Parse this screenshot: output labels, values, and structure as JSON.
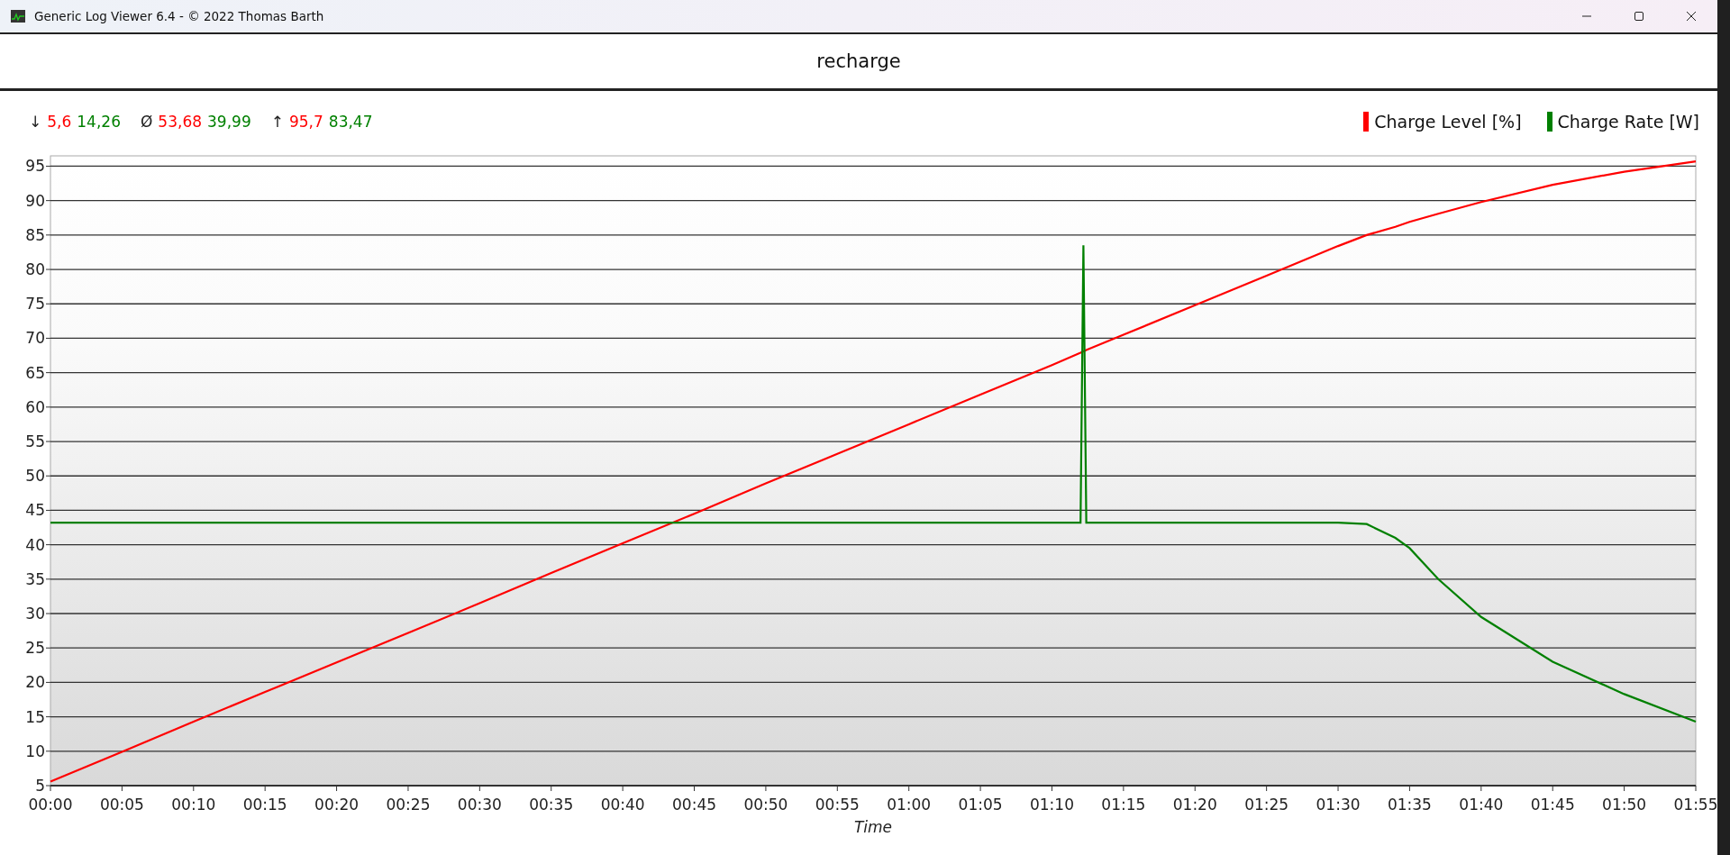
{
  "window": {
    "title": "Generic Log Viewer 6.4 - © 2022 Thomas Barth"
  },
  "header": {
    "title": "recharge"
  },
  "stats": [
    {
      "symbol": "↓",
      "values": [
        {
          "text": "5,6",
          "color": "#ff0000"
        },
        {
          "text": "14,26",
          "color": "#008000"
        }
      ]
    },
    {
      "symbol": "Ø",
      "values": [
        {
          "text": "53,68",
          "color": "#ff0000"
        },
        {
          "text": "39,99",
          "color": "#008000"
        }
      ]
    },
    {
      "symbol": "↑",
      "values": [
        {
          "text": "95,7",
          "color": "#ff0000"
        },
        {
          "text": "83,47",
          "color": "#008000"
        }
      ]
    }
  ],
  "chart_data": {
    "type": "line",
    "grid": true,
    "xlabel": "Time",
    "x": [
      0,
      5,
      10,
      15,
      20,
      25,
      30,
      35,
      40,
      45,
      50,
      55,
      60,
      65,
      70,
      72,
      72.2,
      72.4,
      75,
      80,
      85,
      90,
      92,
      94,
      95,
      97,
      100,
      105,
      110,
      115
    ],
    "series": [
      {
        "name": "Charge Level [%]",
        "color": "#ff0000",
        "values": [
          5.6,
          9.9,
          14.3,
          18.6,
          22.9,
          27.2,
          31.5,
          35.9,
          40.2,
          44.5,
          48.9,
          53.2,
          57.5,
          61.8,
          66.1,
          67.9,
          68.1,
          68.3,
          70.5,
          74.8,
          79.1,
          83.4,
          85.0,
          86.2,
          86.9,
          88.1,
          89.8,
          92.3,
          94.2,
          95.7
        ]
      },
      {
        "name": "Charge Rate [W]",
        "color": "#008000",
        "values": [
          43.2,
          43.2,
          43.2,
          43.2,
          43.2,
          43.2,
          43.2,
          43.2,
          43.2,
          43.2,
          43.2,
          43.2,
          43.2,
          43.2,
          43.2,
          43.2,
          83.5,
          43.2,
          43.2,
          43.2,
          43.2,
          43.2,
          43.0,
          41.0,
          39.5,
          35.0,
          29.5,
          23.0,
          18.3,
          14.3
        ]
      }
    ],
    "xlim": [
      0,
      115
    ],
    "ylim": [
      5,
      96.5
    ],
    "xticks": [
      {
        "value": 0,
        "label": "00:00"
      },
      {
        "value": 5,
        "label": "00:05"
      },
      {
        "value": 10,
        "label": "00:10"
      },
      {
        "value": 15,
        "label": "00:15"
      },
      {
        "value": 20,
        "label": "00:20"
      },
      {
        "value": 25,
        "label": "00:25"
      },
      {
        "value": 30,
        "label": "00:30"
      },
      {
        "value": 35,
        "label": "00:35"
      },
      {
        "value": 40,
        "label": "00:40"
      },
      {
        "value": 45,
        "label": "00:45"
      },
      {
        "value": 50,
        "label": "00:50"
      },
      {
        "value": 55,
        "label": "00:55"
      },
      {
        "value": 60,
        "label": "01:00"
      },
      {
        "value": 65,
        "label": "01:05"
      },
      {
        "value": 70,
        "label": "01:10"
      },
      {
        "value": 75,
        "label": "01:15"
      },
      {
        "value": 80,
        "label": "01:20"
      },
      {
        "value": 85,
        "label": "01:25"
      },
      {
        "value": 90,
        "label": "01:30"
      },
      {
        "value": 95,
        "label": "01:35"
      },
      {
        "value": 100,
        "label": "01:40"
      },
      {
        "value": 105,
        "label": "01:45"
      },
      {
        "value": 110,
        "label": "01:50"
      },
      {
        "value": 115,
        "label": "01:55"
      }
    ],
    "yticks": [
      5,
      10,
      15,
      20,
      25,
      30,
      35,
      40,
      45,
      50,
      55,
      60,
      65,
      70,
      75,
      80,
      85,
      90,
      95
    ]
  }
}
